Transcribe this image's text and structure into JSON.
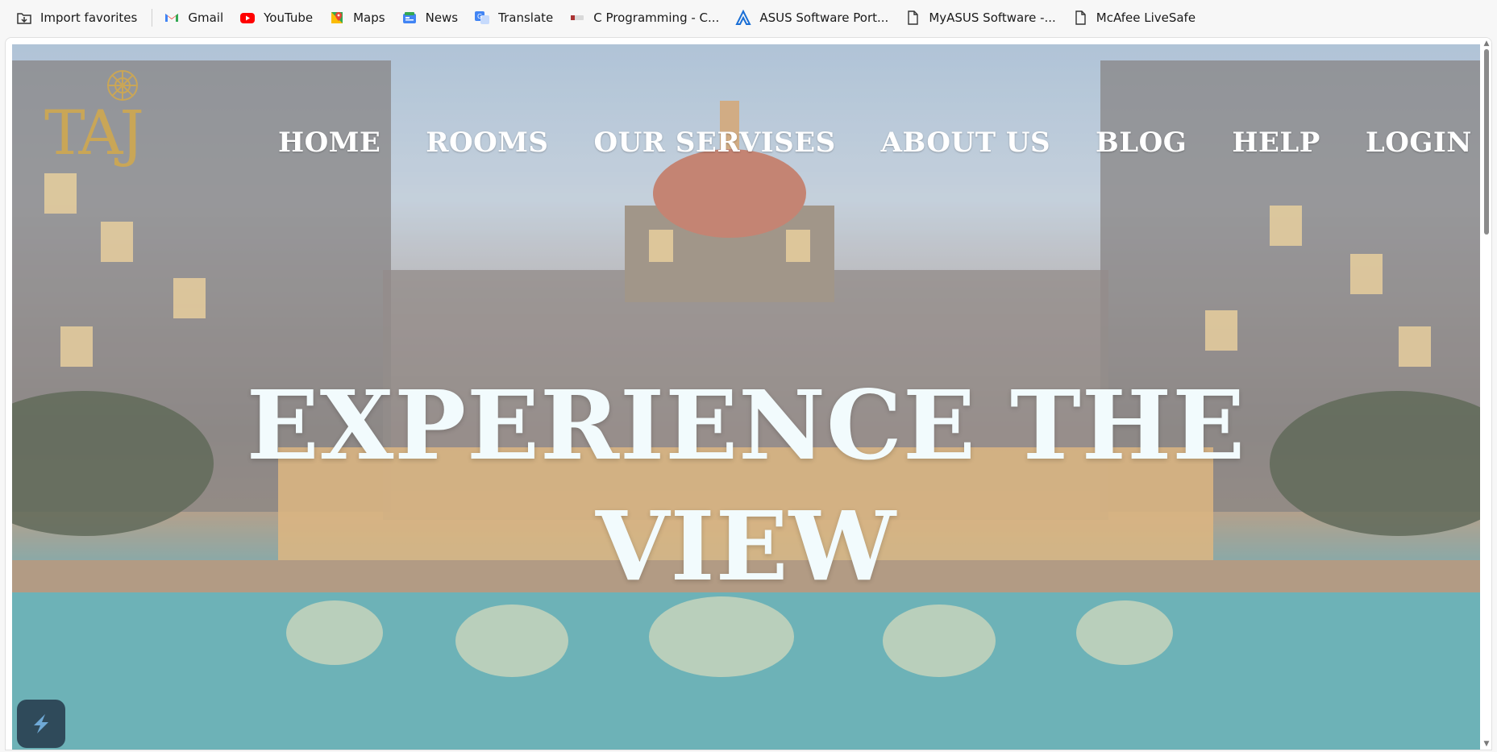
{
  "bookmarks": [
    {
      "label": "Import favorites",
      "icon": "import-icon"
    },
    {
      "label": "Gmail",
      "icon": "gmail-icon"
    },
    {
      "label": "YouTube",
      "icon": "youtube-icon"
    },
    {
      "label": "Maps",
      "icon": "maps-icon"
    },
    {
      "label": "News",
      "icon": "news-icon"
    },
    {
      "label": "Translate",
      "icon": "translate-icon"
    },
    {
      "label": "C Programming - C...",
      "icon": "page-icon"
    },
    {
      "label": "ASUS Software Port...",
      "icon": "asus-icon"
    },
    {
      "label": "MyASUS Software -...",
      "icon": "document-icon"
    },
    {
      "label": "McAfee LiveSafe",
      "icon": "document-icon"
    }
  ],
  "logo": {
    "text": "TAJ"
  },
  "nav": {
    "items": [
      "HOME",
      "ROOMS",
      "OUR SERVISES",
      "ABOUT US",
      "BLOG",
      "HELP",
      "LOGIN"
    ]
  },
  "hero": {
    "line1": "EXPERIENCE THE",
    "line2": "VIEW"
  },
  "colors": {
    "logo_gold": "#c9a657",
    "nav_text": "#ffffff",
    "headline_text": "#f2fbfd"
  }
}
